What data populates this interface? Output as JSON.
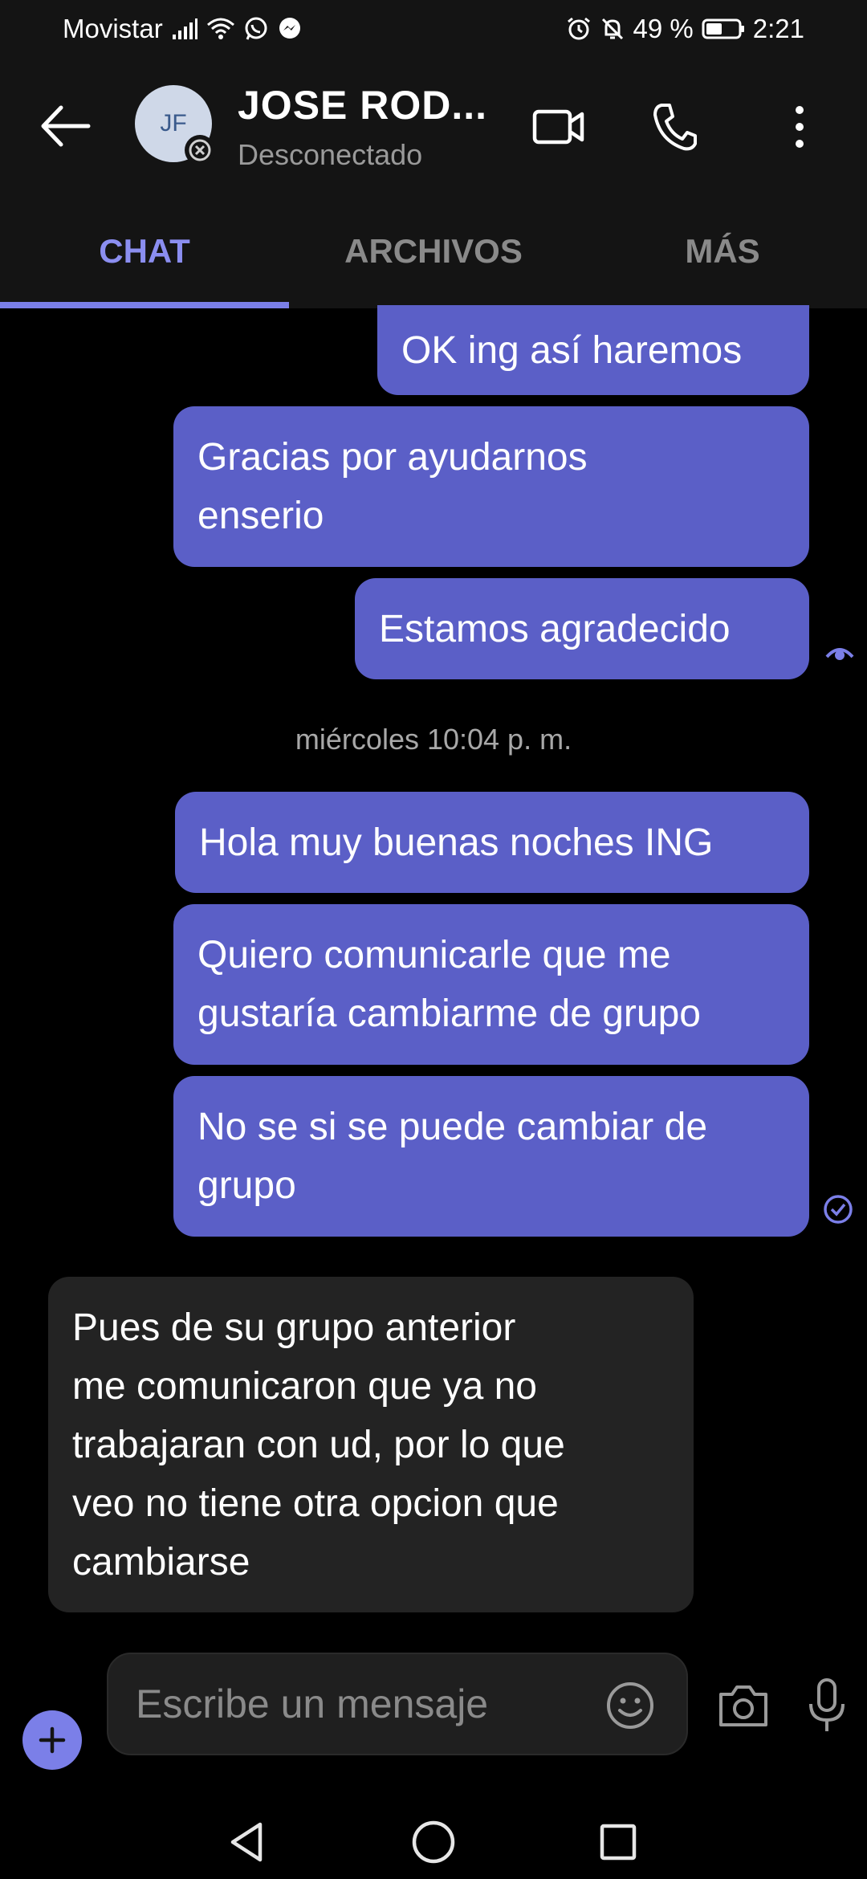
{
  "status_bar": {
    "carrier": "Movistar",
    "battery": "49 %",
    "time": "2:21",
    "icons": [
      "signal-icon",
      "wifi-icon",
      "whatsapp-icon",
      "messenger-icon",
      "alarm-icon",
      "bell-off-icon",
      "battery-icon"
    ]
  },
  "header": {
    "back_icon": "arrow-left-icon",
    "avatar_initials": "JF",
    "contact_name": "JOSE  ROD...",
    "contact_status": "Desconectado",
    "actions": [
      "video-call-icon",
      "phone-icon",
      "more-vertical-icon"
    ]
  },
  "tabs": [
    {
      "label": "CHAT",
      "active": true
    },
    {
      "label": "ARCHIVOS",
      "active": false
    },
    {
      "label": "MÁS",
      "active": false
    }
  ],
  "messages": [
    {
      "direction": "out",
      "lines": [
        "OK ing así haremos"
      ]
    },
    {
      "direction": "out",
      "lines": [
        "Gracias por ayudarnos",
        "enserio"
      ]
    },
    {
      "direction": "out",
      "lines": [
        "Estamos agradecido"
      ],
      "receipt": "seen-icon"
    },
    {
      "direction": "out",
      "lines": [
        "Hola muy buenas noches ING"
      ]
    },
    {
      "direction": "out",
      "lines": [
        "Quiero comunicarle que me",
        "gustaría cambiarme de grupo"
      ]
    },
    {
      "direction": "out",
      "lines": [
        "No se si se puede cambiar de",
        "grupo"
      ],
      "receipt": "delivered-check-icon"
    },
    {
      "direction": "in",
      "lines": [
        "Pues de su grupo anterior",
        "me comunicaron que ya no",
        "trabajaran con ud, por lo que",
        "veo no tiene otra opcion que",
        "cambiarse"
      ]
    }
  ],
  "date_separator": "miércoles 10:04 p. m.",
  "composer": {
    "placeholder": "Escribe un mensaje",
    "value": "",
    "icons": [
      "plus-icon",
      "emoji-icon",
      "camera-icon",
      "microphone-icon"
    ]
  },
  "nav_bar": [
    "back-triangle-icon",
    "home-circle-icon",
    "recents-square-icon"
  ],
  "colors": {
    "accent": "#7b7fe8",
    "outgoing_bubble": "#5b5fc7",
    "incoming_bubble": "#232323",
    "background": "#000000",
    "header": "#141414"
  }
}
